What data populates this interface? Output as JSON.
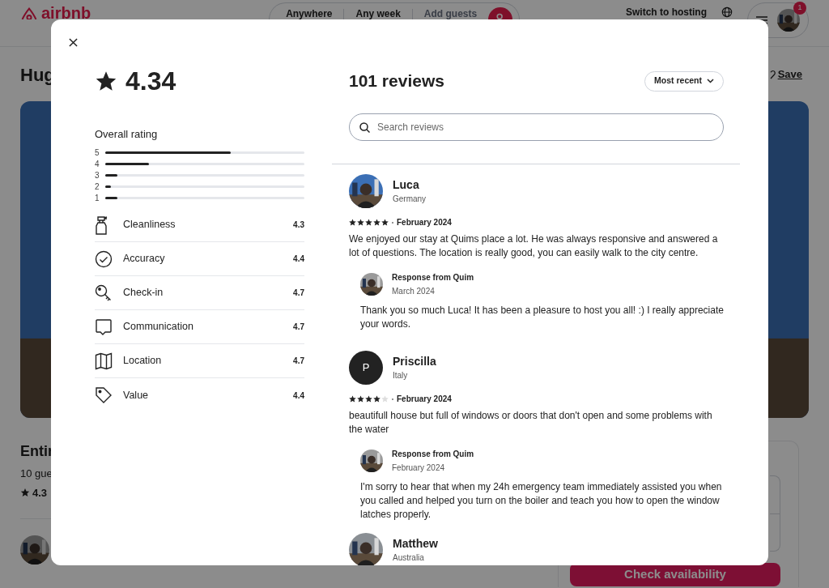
{
  "background_page": {
    "logo": "airbnb",
    "search_segments": [
      "Anywhere",
      "Any week",
      "Add guests"
    ],
    "switch_to_hosting": "Switch to hosting",
    "notification_count": "1",
    "title": "Hug",
    "save": "Save",
    "listing_heading": "Entir",
    "listing_guests": "10 gue",
    "listing_rating": "4.3",
    "check_availability": "Check availability"
  },
  "modal": {
    "rating": "4.34",
    "overall_rating": {
      "title": "Overall rating",
      "bars": [
        {
          "label": "5",
          "level": 0.63
        },
        {
          "label": "4",
          "level": 0.22
        },
        {
          "label": "3",
          "level": 0.06
        },
        {
          "label": "2",
          "level": 0.03
        },
        {
          "label": "1",
          "level": 0.06
        }
      ]
    },
    "categories": [
      {
        "kind": "cleanliness",
        "label": "Cleanliness",
        "value": "4.3"
      },
      {
        "kind": "accuracy",
        "label": "Accuracy",
        "value": "4.4"
      },
      {
        "kind": "checkin",
        "label": "Check-in",
        "value": "4.7"
      },
      {
        "kind": "communication",
        "label": "Communication",
        "value": "4.7"
      },
      {
        "kind": "location",
        "label": "Location",
        "value": "4.7"
      },
      {
        "kind": "value",
        "label": "Value",
        "value": "4.4"
      }
    ],
    "reviews_title": "101 reviews",
    "sort": "Most recent",
    "search": {
      "placeholder": "Search reviews"
    },
    "reviews": [
      {
        "name": "Luca",
        "location": "Germany",
        "stars": 5,
        "date": "February 2024",
        "text": "We enjoyed our stay at Quims place a lot. He was always responsive and answered a lot of questions. The location is really good, you can easily walk to the city centre.",
        "response": {
          "title": "Response from Quim",
          "date": "March 2024",
          "text": "Thank you so much Luca! It has been a pleasure to host you all! :) I really appreciate your words."
        }
      },
      {
        "name": "Priscilla",
        "location": "Italy",
        "avatar": {
          "kind": "initial",
          "letter": "P"
        },
        "stars": 4,
        "date": "February 2024",
        "text": "beautifull house but full of windows or doors that don't open and some problems with the water",
        "response": {
          "title": "Response from Quim",
          "date": "February 2024",
          "text": "I'm sorry to hear that when my 24h emergency team immediately assisted you when you called and helped you turn on the boiler and teach you how to open the window latches properly."
        }
      },
      {
        "name": "Matthew",
        "location": "Australia"
      }
    ]
  }
}
